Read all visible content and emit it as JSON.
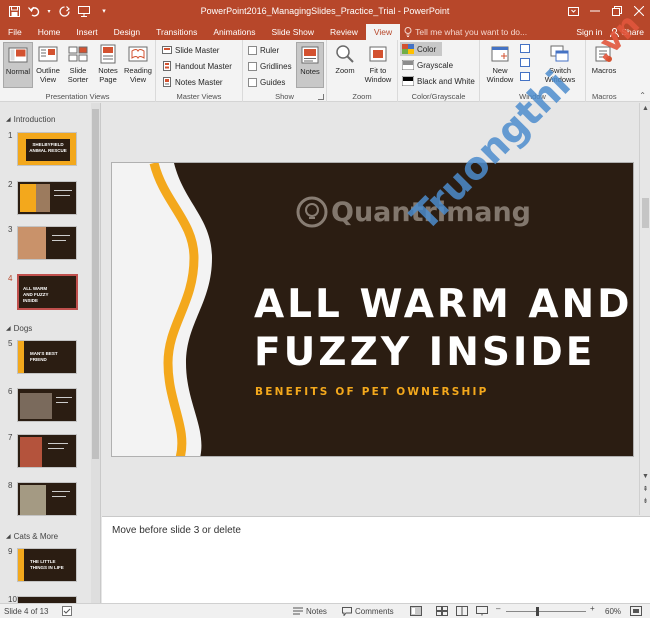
{
  "window": {
    "title": "PowerPoint2016_ManagingSlides_Practice_Trial - PowerPoint"
  },
  "tabs": [
    {
      "label": "File"
    },
    {
      "label": "Home"
    },
    {
      "label": "Insert"
    },
    {
      "label": "Design"
    },
    {
      "label": "Transitions"
    },
    {
      "label": "Animations"
    },
    {
      "label": "Slide Show"
    },
    {
      "label": "Review"
    },
    {
      "label": "View",
      "active": true
    }
  ],
  "tellme": "Tell me what you want to do...",
  "signin": "Sign in",
  "share": "Share",
  "ribbon": {
    "presentation_views": {
      "label": "Presentation Views",
      "normal": "Normal",
      "outline": "Outline View",
      "sorter": "Slide Sorter",
      "notes_page": "Notes Page",
      "reading": "Reading View"
    },
    "master_views": {
      "label": "Master Views",
      "slide_master": "Slide Master",
      "handout_master": "Handout Master",
      "notes_master": "Notes Master"
    },
    "show": {
      "label": "Show",
      "ruler": "Ruler",
      "gridlines": "Gridlines",
      "guides": "Guides",
      "notes": "Notes"
    },
    "zoom": {
      "label": "Zoom",
      "zoom": "Zoom",
      "fit": "Fit to Window"
    },
    "color": {
      "label": "Color/Grayscale",
      "color": "Color",
      "grayscale": "Grayscale",
      "bw": "Black and White"
    },
    "window": {
      "label": "Window",
      "new_window": "New Window",
      "switch": "Switch Windows"
    },
    "macros": {
      "label": "Macros",
      "macros": "Macros"
    }
  },
  "thumbnails": {
    "sections": [
      {
        "name": "Introduction"
      },
      {
        "name": "Dogs"
      },
      {
        "name": "Cats & More"
      }
    ],
    "slides": [
      {
        "num": "1",
        "text": "SHELBYFIELD ANIMAL RESCUE"
      },
      {
        "num": "2",
        "text": ""
      },
      {
        "num": "3",
        "text": ""
      },
      {
        "num": "4",
        "text": "ALL WARM AND FUZZY INSIDE"
      },
      {
        "num": "5",
        "text": "MAN'S BEST FRIEND"
      },
      {
        "num": "6",
        "text": ""
      },
      {
        "num": "7",
        "text": ""
      },
      {
        "num": "8",
        "text": ""
      },
      {
        "num": "9",
        "text": "THE LITTLE THINGS IN LIFE"
      },
      {
        "num": "10",
        "text": ""
      }
    ]
  },
  "slide": {
    "title_line1": "ALL WARM AND",
    "title_line2": "FUZZY INSIDE",
    "subtitle": "BENEFITS OF PET OWNERSHIP"
  },
  "watermark": {
    "quantrimang": "Quantrimang",
    "truongthi": "Truongthi",
    "vn": ".vn"
  },
  "notes": {
    "text": "Move before slide 3 or delete"
  },
  "status": {
    "slide_of": "Slide 4 of 13",
    "notes": "Notes",
    "comments": "Comments",
    "zoom": "60%",
    "zoom_minus": "–",
    "zoom_plus": "+"
  },
  "colors": {
    "accent": "#b7472a",
    "slide_bg": "#2b1d12",
    "slide_gold": "#f3a81c"
  }
}
